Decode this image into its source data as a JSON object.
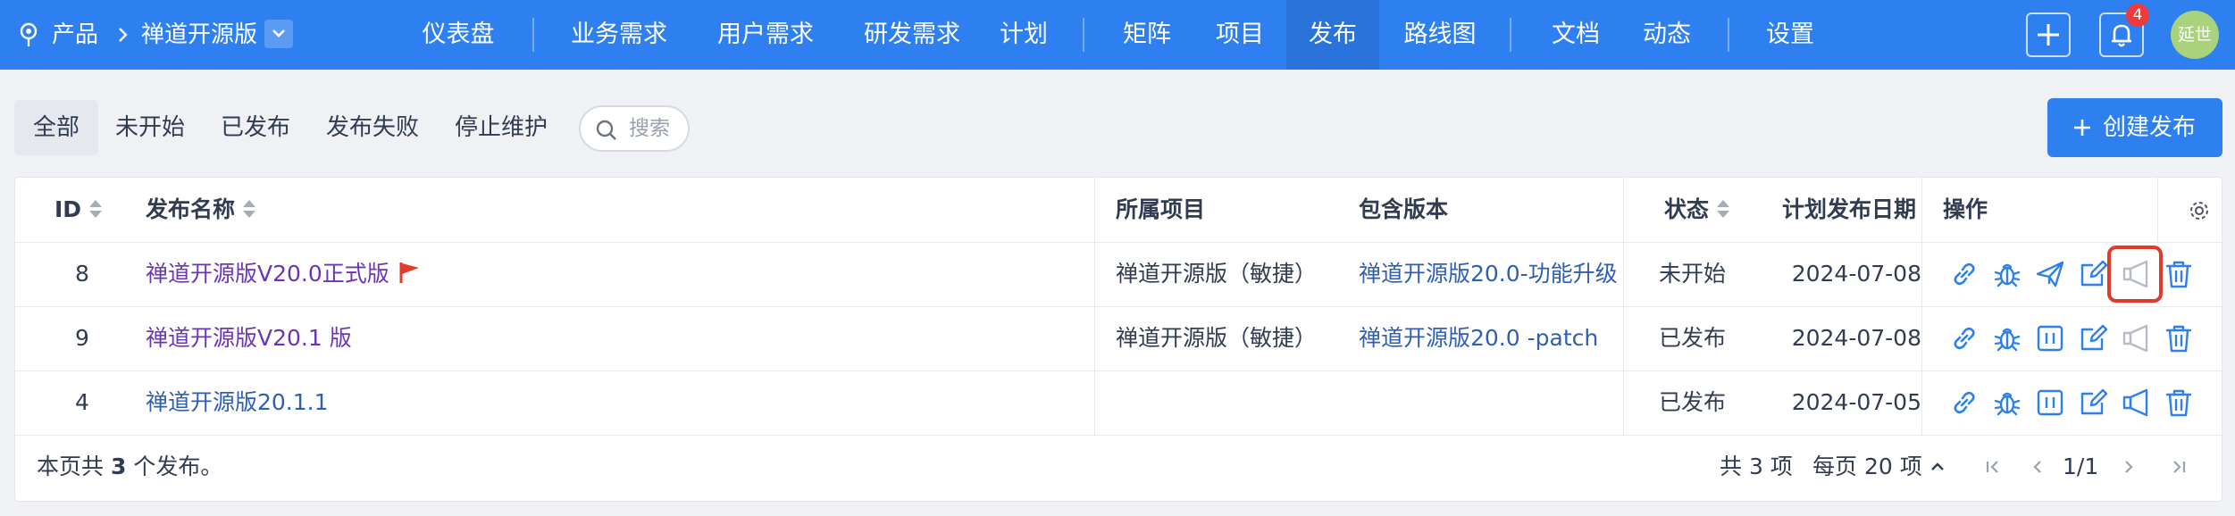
{
  "breadcrumb": {
    "root": "产品",
    "product": "禅道开源版"
  },
  "nav": {
    "items": [
      "仪表盘",
      "业务需求",
      "用户需求",
      "研发需求",
      "计划",
      "矩阵",
      "项目",
      "发布",
      "路线图",
      "文档",
      "动态",
      "设置"
    ],
    "active": "发布"
  },
  "header_actions": {
    "notification_count": "4",
    "avatar_text": "延世"
  },
  "filters": {
    "tabs": [
      "全部",
      "未开始",
      "已发布",
      "发布失败",
      "停止维护"
    ],
    "active": "全部",
    "search_placeholder": "搜索"
  },
  "create_button": "创建发布",
  "table": {
    "columns": {
      "id": "ID",
      "name": "发布名称",
      "project": "所属项目",
      "builds": "包含版本",
      "status": "状态",
      "date": "计划发布日期",
      "actions": "操作"
    },
    "rows": [
      {
        "id": "8",
        "name": "禅道开源版V20.0正式版",
        "project": "禅道开源版（敏捷）",
        "builds": "禅道开源版20.0-功能升级",
        "status": "未开始",
        "date": "2024-07-08"
      },
      {
        "id": "9",
        "name": "禅道开源版V20.1 版",
        "project": "禅道开源版（敏捷）",
        "builds": "禅道开源版20.0 -patch",
        "status": "已发布",
        "date": "2024-07-08"
      },
      {
        "id": "4",
        "name": "禅道开源版20.1.1",
        "project": "",
        "builds": "",
        "status": "已发布",
        "date": "2024-07-05"
      }
    ]
  },
  "footer": {
    "summary_prefix": "本页共",
    "summary_count": "3",
    "summary_suffix": "个发布。",
    "total": "共 3 项",
    "per_page": "每页 20 项",
    "page": "1/1"
  },
  "colors": {
    "primary": "#2e7ff0",
    "highlight": "#e23a2a",
    "flag": "#e03b2b"
  }
}
